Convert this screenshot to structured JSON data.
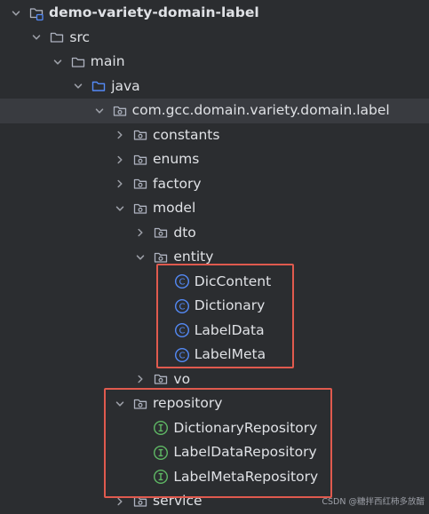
{
  "tree": [
    {
      "name": "tree-item-demo-variety-domain-label",
      "label": "demo-variety-domain-label",
      "icon": "module-folder-icon",
      "chevron": "down",
      "depth": 0,
      "bold": true
    },
    {
      "name": "tree-item-src",
      "label": "src",
      "icon": "folder-icon",
      "chevron": "down",
      "depth": 1
    },
    {
      "name": "tree-item-main",
      "label": "main",
      "icon": "folder-icon",
      "chevron": "down",
      "depth": 2
    },
    {
      "name": "tree-item-java",
      "label": "java",
      "icon": "source-folder-icon",
      "chevron": "down",
      "depth": 3
    },
    {
      "name": "tree-item-package-root",
      "label": "com.gcc.domain.variety.domain.label",
      "icon": "package-icon",
      "chevron": "down",
      "depth": 4,
      "selected": true
    },
    {
      "name": "tree-item-constants",
      "label": "constants",
      "icon": "package-icon",
      "chevron": "right",
      "depth": 5
    },
    {
      "name": "tree-item-enums",
      "label": "enums",
      "icon": "package-icon",
      "chevron": "right",
      "depth": 5
    },
    {
      "name": "tree-item-factory",
      "label": "factory",
      "icon": "package-icon",
      "chevron": "right",
      "depth": 5
    },
    {
      "name": "tree-item-model",
      "label": "model",
      "icon": "package-icon",
      "chevron": "down",
      "depth": 5
    },
    {
      "name": "tree-item-dto",
      "label": "dto",
      "icon": "package-icon",
      "chevron": "right",
      "depth": 6
    },
    {
      "name": "tree-item-entity",
      "label": "entity",
      "icon": "package-icon",
      "chevron": "down",
      "depth": 6
    },
    {
      "name": "tree-item-diccontent",
      "label": "DicContent",
      "icon": "class-icon",
      "chevron": "none",
      "depth": 7
    },
    {
      "name": "tree-item-dictionary",
      "label": "Dictionary",
      "icon": "class-icon",
      "chevron": "none",
      "depth": 7
    },
    {
      "name": "tree-item-labeldata",
      "label": "LabelData",
      "icon": "class-icon",
      "chevron": "none",
      "depth": 7
    },
    {
      "name": "tree-item-labelmeta",
      "label": "LabelMeta",
      "icon": "class-icon",
      "chevron": "none",
      "depth": 7
    },
    {
      "name": "tree-item-vo",
      "label": "vo",
      "icon": "package-icon",
      "chevron": "right",
      "depth": 6
    },
    {
      "name": "tree-item-repository",
      "label": "repository",
      "icon": "package-icon",
      "chevron": "down",
      "depth": 5
    },
    {
      "name": "tree-item-dictionaryrepository",
      "label": "DictionaryRepository",
      "icon": "interface-icon",
      "chevron": "none",
      "depth": 6
    },
    {
      "name": "tree-item-labeldatarepository",
      "label": "LabelDataRepository",
      "icon": "interface-icon",
      "chevron": "none",
      "depth": 6
    },
    {
      "name": "tree-item-labelmetarepository",
      "label": "LabelMetaRepository",
      "icon": "interface-icon",
      "chevron": "none",
      "depth": 6
    },
    {
      "name": "tree-item-service",
      "label": "service",
      "icon": "package-icon",
      "chevron": "right",
      "depth": 5
    }
  ],
  "colors": {
    "background": "#2b2d30",
    "text": "#dfe1e5",
    "selected_row": "#393b40",
    "chevron": "#9da0a8",
    "folder_stroke": "#aeb3c0",
    "source_folder": "#548af7",
    "class_icon": "#548af7",
    "interface_icon": "#5fb865",
    "highlight_box": "#e05a4e"
  },
  "highlight_groups": [
    {
      "name": "entity-classes-highlight"
    },
    {
      "name": "repository-highlight"
    }
  ],
  "watermark": "CSDN @糖拌西红柿多放醋"
}
